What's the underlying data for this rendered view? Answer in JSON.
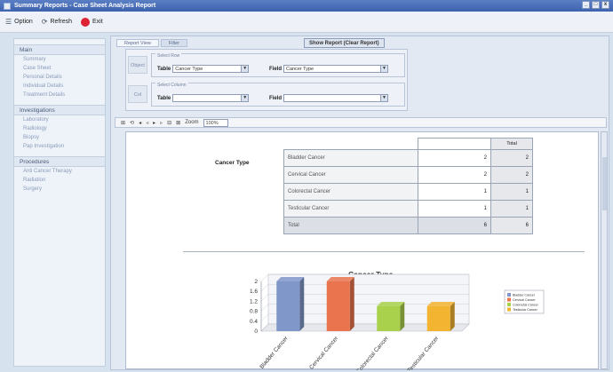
{
  "window": {
    "title": "Summary Reports - Case Sheet Analysis Report",
    "controls": [
      "_",
      "□",
      "x"
    ]
  },
  "menubar": {
    "items": [
      {
        "label": "Option",
        "icon": "options-icon"
      },
      {
        "label": "Refresh",
        "icon": "refresh-icon"
      },
      {
        "label": "Exit",
        "icon": "stop-icon"
      }
    ]
  },
  "sidebar": {
    "groups": [
      {
        "title": "Main",
        "items": [
          "Summary",
          "Case Sheet",
          "Personal Details",
          "Individual Details",
          "Treatment Details"
        ]
      },
      {
        "title": "Investigations",
        "items": [
          "Laboratory",
          "Radiology",
          "Biopsy",
          "Pap Investigation"
        ]
      },
      {
        "title": "Procedures",
        "items": [
          "Anti Cancer Therapy",
          "Radiation",
          "Surgery"
        ]
      }
    ]
  },
  "tabs": [
    {
      "label": "Report View",
      "active": true
    },
    {
      "label": "Filter",
      "active": false
    }
  ],
  "show_report_label": "Show Report (Clear Report)",
  "config": {
    "rows": [
      {
        "side_label": "Object",
        "legend": "Select Row",
        "table_label": "Table",
        "table_value": "Cancer Type",
        "field_label": "Field",
        "field_value": "Cancer Type"
      },
      {
        "side_label": "Col",
        "legend": "Select Column",
        "table_label": "Table",
        "table_value": "",
        "field_label": "Field",
        "field_value": ""
      }
    ]
  },
  "toolbar": {
    "buttons": [
      "⊞",
      "⟲",
      "◂",
      "◃",
      "▸",
      "▹",
      "⊟",
      "⊠"
    ],
    "zoom_label": "Zoom",
    "zoom_value": "100%"
  },
  "report": {
    "row_label": "Cancer Type",
    "total_header": "Total",
    "rows": [
      {
        "name": "Bladder Cancer",
        "value": "2",
        "total": "2"
      },
      {
        "name": "Cervical Cancer",
        "value": "2",
        "total": "2"
      },
      {
        "name": "Colorectal Cancer",
        "value": "1",
        "total": "1"
      },
      {
        "name": "Testicular Cancer",
        "value": "1",
        "total": "1"
      },
      {
        "name": "Total",
        "value": "6",
        "total": "6"
      }
    ]
  },
  "chart_data": {
    "type": "bar",
    "title": "Cancer Type",
    "categories": [
      "Bladder Cancer",
      "Cervical Cancer",
      "Colorectal Cancer",
      "Testicular Cancer"
    ],
    "values": [
      2,
      2,
      1,
      1
    ],
    "colors": [
      "#7f97c9",
      "#e9744e",
      "#a9d14c",
      "#f2b431"
    ],
    "ylim": [
      0,
      2
    ],
    "yticks": [
      "2",
      "1.6",
      "1.2",
      "0.8",
      "0.4",
      "0"
    ],
    "legend_position": "right",
    "legend_labels": [
      "Bladder Cancer",
      "Cervical Cancer",
      "Colorectal Cancer",
      "Testicular Cancer"
    ],
    "grid": true
  }
}
